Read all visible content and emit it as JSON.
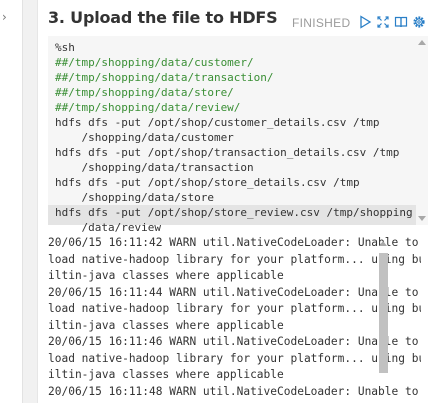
{
  "paragraph": {
    "title": "3. Upload the file to HDFS",
    "status": "FINISHED",
    "icons": [
      "run-icon",
      "expand-icon",
      "book-icon",
      "settings-icon"
    ],
    "colors": {
      "status": "#9b9b9b",
      "comment": "#3a8f35",
      "icon_accent": "#2a7fc7"
    }
  },
  "editor": {
    "lines": [
      "%sh",
      "##/tmp/shopping/data/customer/",
      "##/tmp/shopping/data/transaction/",
      "##/tmp/shopping/data/store/",
      "##/tmp/shopping/data/review/",
      "hdfs dfs -put /opt/shop/customer_details.csv /tmp",
      "    /shopping/data/customer",
      "hdfs dfs -put /opt/shop/transaction_details.csv /tmp",
      "    /shopping/data/transaction",
      "hdfs dfs -put /opt/shop/store_details.csv /tmp",
      "    /shopping/data/store",
      "hdfs dfs -put /opt/shop/store_review.csv /tmp/shopping",
      "    /data/review"
    ]
  },
  "output": {
    "lines": [
      "20/06/15 16:11:42 WARN util.NativeCodeLoader: Unable to",
      "load native-hadoop library for your platform... using bu",
      "iltin-java classes where applicable",
      "20/06/15 16:11:44 WARN util.NativeCodeLoader: Unable to",
      "load native-hadoop library for your platform... using bu",
      "iltin-java classes where applicable",
      "20/06/15 16:11:46 WARN util.NativeCodeLoader: Unable to",
      "load native-hadoop library for your platform... using bu",
      "iltin-java classes where applicable",
      "20/06/15 16:11:48 WARN util.NativeCodeLoader: Unable to"
    ]
  }
}
